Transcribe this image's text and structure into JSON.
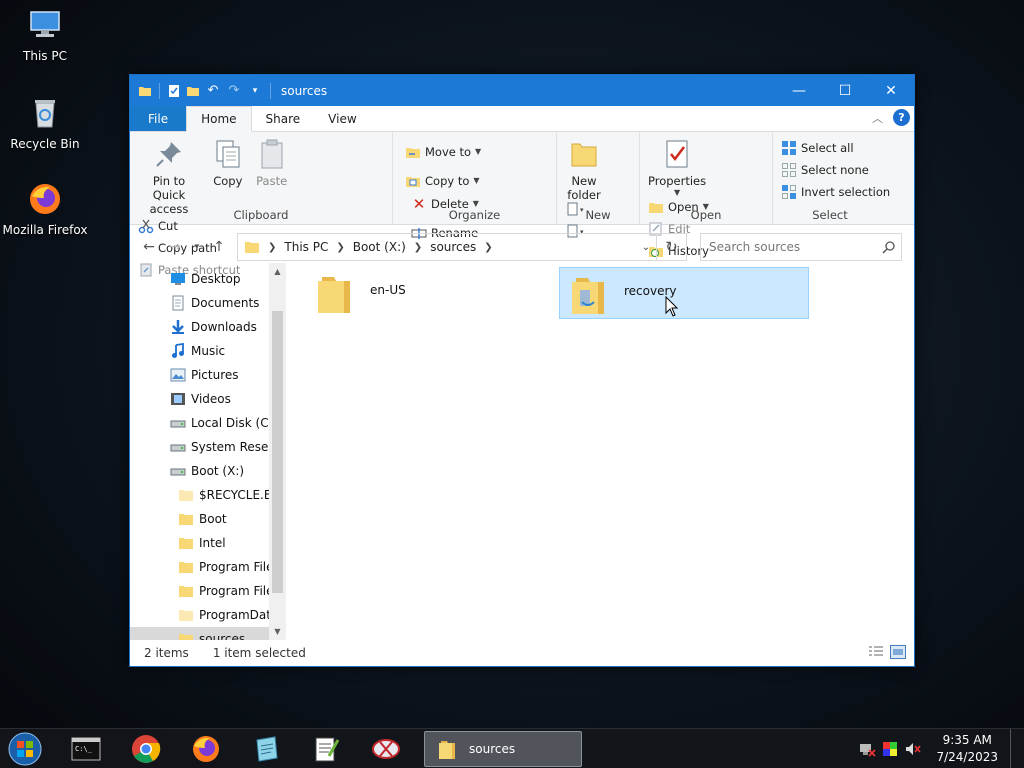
{
  "desktop": {
    "icons": [
      {
        "label": "This PC"
      },
      {
        "label": "Recycle Bin"
      },
      {
        "label": "Mozilla Firefox"
      }
    ]
  },
  "window": {
    "title": "sources",
    "tabs": [
      "File",
      "Home",
      "Share",
      "View"
    ],
    "ribbon": {
      "clipboard": {
        "name": "Clipboard",
        "pin": "Pin to Quick access",
        "copy": "Copy",
        "paste": "Paste",
        "cut": "Cut",
        "copy_path": "Copy path",
        "paste_shortcut": "Paste shortcut"
      },
      "organize": {
        "name": "Organize",
        "move_to": "Move to",
        "copy_to": "Copy to",
        "delete": "Delete",
        "rename": "Rename"
      },
      "new": {
        "name": "New",
        "new_folder": "New folder"
      },
      "open": {
        "name": "Open",
        "properties": "Properties",
        "open": "Open",
        "edit": "Edit",
        "history": "History"
      },
      "select": {
        "name": "Select",
        "select_all": "Select all",
        "select_none": "Select none",
        "invert_selection": "Invert selection"
      }
    },
    "address": {
      "crumbs": [
        "This PC",
        "Boot (X:)",
        "sources"
      ],
      "search_placeholder": "Search sources"
    },
    "nav_items": [
      {
        "label": "Desktop",
        "icon": "desktop-icon"
      },
      {
        "label": "Documents",
        "icon": "documents-icon"
      },
      {
        "label": "Downloads",
        "icon": "downloads-icon"
      },
      {
        "label": "Music",
        "icon": "music-icon"
      },
      {
        "label": "Pictures",
        "icon": "pictures-icon"
      },
      {
        "label": "Videos",
        "icon": "videos-icon"
      },
      {
        "label": "Local Disk (C:)",
        "icon": "drive-icon"
      },
      {
        "label": "System Reserve",
        "icon": "drive-icon"
      },
      {
        "label": "Boot (X:)",
        "icon": "drive-icon"
      },
      {
        "label": "$RECYCLE.BIN",
        "icon": "folder-icon"
      },
      {
        "label": "Boot",
        "icon": "folder-icon"
      },
      {
        "label": "Intel",
        "icon": "folder-icon"
      },
      {
        "label": "Program Files",
        "icon": "folder-icon"
      },
      {
        "label": "Program Files",
        "icon": "folder-icon"
      },
      {
        "label": "ProgramData",
        "icon": "folder-icon"
      },
      {
        "label": "sources",
        "icon": "folder-icon"
      }
    ],
    "files": [
      {
        "name": "en-US",
        "selected": false
      },
      {
        "name": "recovery",
        "selected": true
      }
    ],
    "status": {
      "items": "2 items",
      "selected": "1 item selected"
    }
  },
  "taskbar": {
    "task_label": "sources",
    "time": "9:35 AM",
    "date": "7/24/2023"
  },
  "colors": {
    "titlebar": "#1c7ad6",
    "selection": "#cce8ff",
    "folder": "#f8d775"
  }
}
